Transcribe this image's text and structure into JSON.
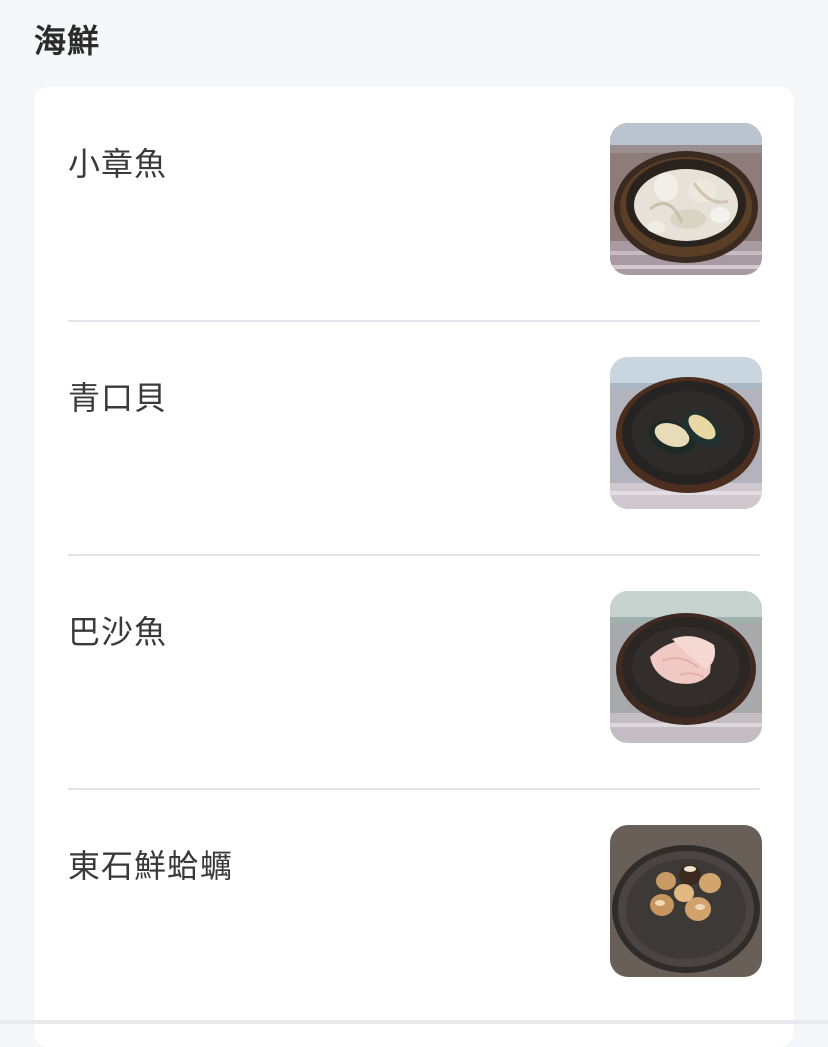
{
  "section": {
    "title": "海鮮"
  },
  "items": [
    {
      "name": "小章魚",
      "icon": "baby-octopus-photo"
    },
    {
      "name": "青口貝",
      "icon": "mussels-photo"
    },
    {
      "name": "巴沙魚",
      "icon": "basa-fish-photo"
    },
    {
      "name": "東石鮮蛤蠣",
      "icon": "clams-photo"
    }
  ],
  "colors": {
    "page_background": "#f6f7fb",
    "card_background": "#ffffff",
    "divider": "#e4e5ea",
    "text": "#3a3a3a"
  }
}
